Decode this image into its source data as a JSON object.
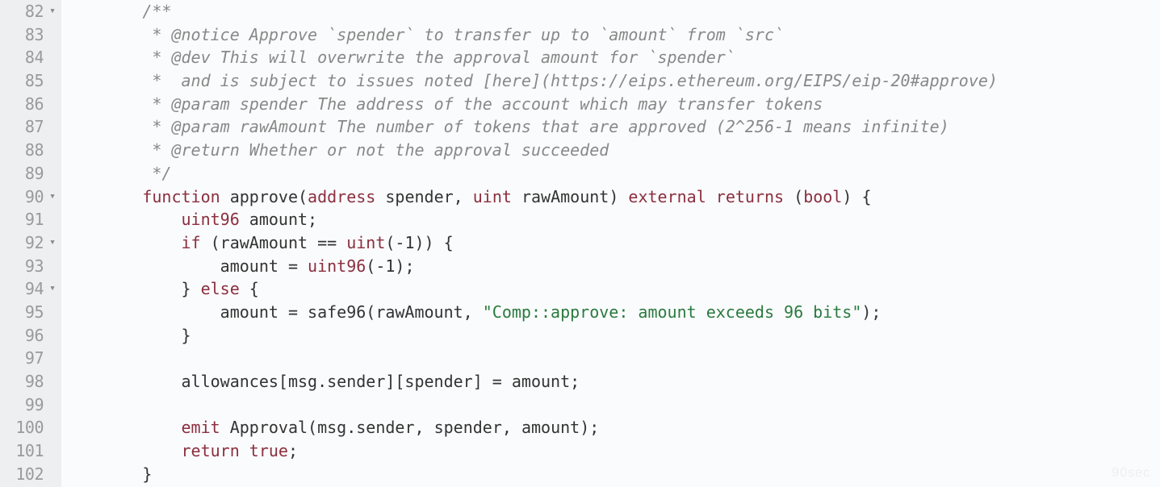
{
  "editor": {
    "watermark": "90sec",
    "lines": [
      {
        "num": "82",
        "fold": "▾",
        "tokens": [
          {
            "t": "plain",
            "v": "        "
          },
          {
            "t": "comment",
            "v": "/**"
          }
        ]
      },
      {
        "num": "83",
        "fold": "",
        "tokens": [
          {
            "t": "plain",
            "v": "         "
          },
          {
            "t": "comment",
            "v": "* @notice Approve `spender` to transfer up to `amount` from `src`"
          }
        ]
      },
      {
        "num": "84",
        "fold": "",
        "tokens": [
          {
            "t": "plain",
            "v": "         "
          },
          {
            "t": "comment",
            "v": "* @dev This will overwrite the approval amount for `spender`"
          }
        ]
      },
      {
        "num": "85",
        "fold": "",
        "tokens": [
          {
            "t": "plain",
            "v": "         "
          },
          {
            "t": "comment",
            "v": "*  and is subject to issues noted [here](https://eips.ethereum.org/EIPS/eip-20#approve)"
          }
        ]
      },
      {
        "num": "86",
        "fold": "",
        "tokens": [
          {
            "t": "plain",
            "v": "         "
          },
          {
            "t": "comment",
            "v": "* @param spender The address of the account which may transfer tokens"
          }
        ]
      },
      {
        "num": "87",
        "fold": "",
        "tokens": [
          {
            "t": "plain",
            "v": "         "
          },
          {
            "t": "comment",
            "v": "* @param rawAmount The number of tokens that are approved (2^256-1 means infinite)"
          }
        ]
      },
      {
        "num": "88",
        "fold": "",
        "tokens": [
          {
            "t": "plain",
            "v": "         "
          },
          {
            "t": "comment",
            "v": "* @return Whether or not the approval succeeded"
          }
        ]
      },
      {
        "num": "89",
        "fold": "",
        "tokens": [
          {
            "t": "plain",
            "v": "         "
          },
          {
            "t": "comment",
            "v": "*/"
          }
        ]
      },
      {
        "num": "90",
        "fold": "▾",
        "tokens": [
          {
            "t": "plain",
            "v": "        "
          },
          {
            "t": "keyword",
            "v": "function"
          },
          {
            "t": "plain",
            "v": " approve("
          },
          {
            "t": "type",
            "v": "address"
          },
          {
            "t": "plain",
            "v": " spender, "
          },
          {
            "t": "type",
            "v": "uint"
          },
          {
            "t": "plain",
            "v": " rawAmount) "
          },
          {
            "t": "keyword",
            "v": "external"
          },
          {
            "t": "plain",
            "v": " "
          },
          {
            "t": "keyword",
            "v": "returns"
          },
          {
            "t": "plain",
            "v": " ("
          },
          {
            "t": "type",
            "v": "bool"
          },
          {
            "t": "plain",
            "v": ") {"
          }
        ]
      },
      {
        "num": "91",
        "fold": "",
        "tokens": [
          {
            "t": "plain",
            "v": "            "
          },
          {
            "t": "type",
            "v": "uint96"
          },
          {
            "t": "plain",
            "v": " amount;"
          }
        ]
      },
      {
        "num": "92",
        "fold": "▾",
        "tokens": [
          {
            "t": "plain",
            "v": "            "
          },
          {
            "t": "keyword",
            "v": "if"
          },
          {
            "t": "plain",
            "v": " (rawAmount == "
          },
          {
            "t": "type",
            "v": "uint"
          },
          {
            "t": "plain",
            "v": "(-1)) {"
          }
        ]
      },
      {
        "num": "93",
        "fold": "",
        "tokens": [
          {
            "t": "plain",
            "v": "                amount = "
          },
          {
            "t": "type",
            "v": "uint96"
          },
          {
            "t": "plain",
            "v": "(-1);"
          }
        ]
      },
      {
        "num": "94",
        "fold": "▾",
        "tokens": [
          {
            "t": "plain",
            "v": "            } "
          },
          {
            "t": "keyword",
            "v": "else"
          },
          {
            "t": "plain",
            "v": " {"
          }
        ]
      },
      {
        "num": "95",
        "fold": "",
        "tokens": [
          {
            "t": "plain",
            "v": "                amount = safe96(rawAmount, "
          },
          {
            "t": "string",
            "v": "\"Comp::approve: amount exceeds 96 bits\""
          },
          {
            "t": "plain",
            "v": ");"
          }
        ]
      },
      {
        "num": "96",
        "fold": "",
        "tokens": [
          {
            "t": "plain",
            "v": "            }"
          }
        ]
      },
      {
        "num": "97",
        "fold": "",
        "tokens": [
          {
            "t": "plain",
            "v": ""
          }
        ]
      },
      {
        "num": "98",
        "fold": "",
        "tokens": [
          {
            "t": "plain",
            "v": "            allowances[msg.sender][spender] = amount;"
          }
        ]
      },
      {
        "num": "99",
        "fold": "",
        "tokens": [
          {
            "t": "plain",
            "v": ""
          }
        ]
      },
      {
        "num": "100",
        "fold": "",
        "tokens": [
          {
            "t": "plain",
            "v": "            "
          },
          {
            "t": "keyword",
            "v": "emit"
          },
          {
            "t": "plain",
            "v": " Approval(msg.sender, spender, amount);"
          }
        ]
      },
      {
        "num": "101",
        "fold": "",
        "tokens": [
          {
            "t": "plain",
            "v": "            "
          },
          {
            "t": "keyword",
            "v": "return"
          },
          {
            "t": "plain",
            "v": " "
          },
          {
            "t": "builtin",
            "v": "true"
          },
          {
            "t": "plain",
            "v": ";"
          }
        ]
      },
      {
        "num": "102",
        "fold": "",
        "tokens": [
          {
            "t": "plain",
            "v": "        }"
          }
        ]
      }
    ]
  }
}
